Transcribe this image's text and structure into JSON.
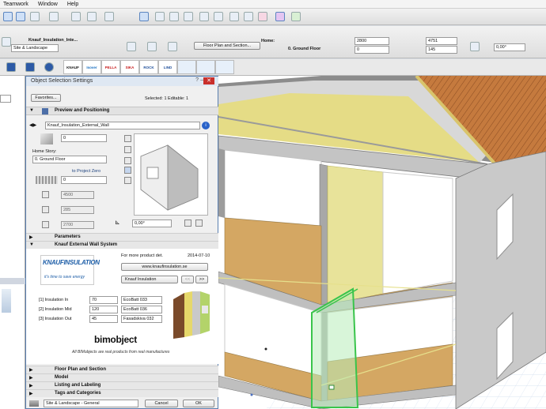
{
  "menu": [
    "Teamwork",
    "Window",
    "Help"
  ],
  "toolbar": {
    "object_name": "Knauf_Insulation_Inte...",
    "layer": "Site & Landscape",
    "view_button": "Floor Plan and Section...",
    "home_label": "Home:",
    "home_value": "0. Ground Floor",
    "field1_value": "2800",
    "field2_value": "0",
    "field3_value": "4751",
    "field4_value": "145",
    "angle_value": "0,00°"
  },
  "brands": [
    "KNAUF",
    "Isover",
    "PELLA",
    "SIKA",
    "ROCK",
    "LIND",
    "",
    "",
    ""
  ],
  "dialog": {
    "title": "Object Selection Settings",
    "favorites_label": "Favorites...",
    "selected_status": "Selected: 1 Editable: 1",
    "preview_section": "Preview and Positioning",
    "object_name": "Knauf_Insulation_External_Wall",
    "offset_value": "0",
    "home_story_label": "Home Story:",
    "home_story_value": "0. Ground Floor",
    "to_project_zero": "to Project Zero",
    "elevation_value": "0",
    "width_value": "4500",
    "depth_value": "285",
    "height_value": "2700",
    "angle_value": "0,00°",
    "parameters_section": "Parameters",
    "knauf_section": "Knauf External Wall System",
    "logo_text": "KNAUFINSULATION",
    "logo_tagline": "it's time to save energy",
    "product_details_label": "For more product det.",
    "date": "2014-07-10",
    "website": "www.knaufinsulation.se",
    "manufacturer": "Knauf Insulation",
    "nav_prev": "<<",
    "nav_next": ">>",
    "insulation_rows": [
      {
        "label": "[1] Insulation In",
        "value": "70",
        "product": "EcoBatt 033"
      },
      {
        "label": "[2] Insulation Mid",
        "value": "120",
        "product": "EcoBatt 036"
      },
      {
        "label": "[3] Insulation Out",
        "value": "45",
        "product": "Fasadskiva 032"
      }
    ],
    "bimobject_logo": "bimobject",
    "bimobject_tagline": "All BIMobjects are real products from real manufactures",
    "bottom_sections": [
      "Floor Plan and Section",
      "Model",
      "Listing and Labeling",
      "Tags and Categories"
    ],
    "footer_layer": "Site & Landscape - General",
    "cancel_label": "Cancel",
    "ok_label": "OK"
  },
  "colors": {
    "title_bar": "#dfe8f3",
    "close_button": "#c9302c",
    "knauf_blue": "#1f5fa8",
    "wall_grey": "#b9b9b9",
    "floor_wood": "#d4a763",
    "insulation_yellow": "#e8e39a",
    "roof_tile": "#c57a3e",
    "selection_green": "#39c44b"
  }
}
